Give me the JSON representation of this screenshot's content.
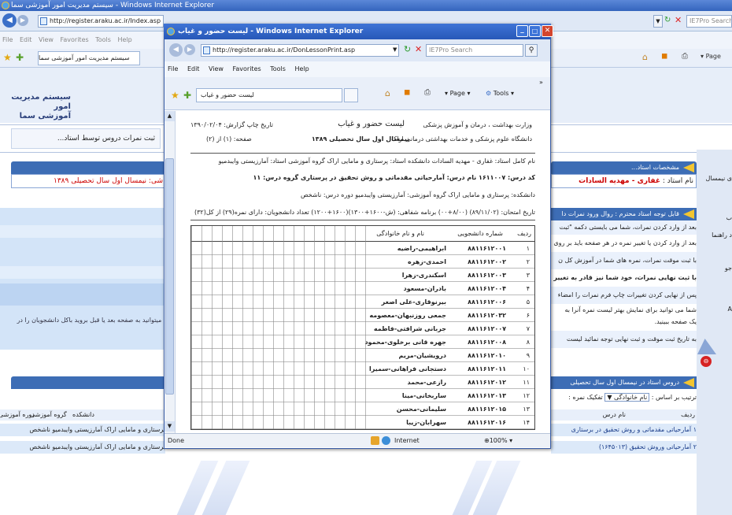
{
  "outer": {
    "title": "سیستم مدیریت امور آموزشی سما - Windows Internet Explorer",
    "address": "http://register.araku.ac.ir/Index.asp",
    "search_placeholder": "IE7Pro Search",
    "menu": [
      "File",
      "Edit",
      "View",
      "Favorites",
      "Tools",
      "Help"
    ],
    "tab_title": "سیستم مدیریت امور آموزشی سما",
    "toolbar_page": "Page"
  },
  "site": {
    "logo_line1": "سیستم مدیریت امور",
    "logo_line2": "آموزشی سما",
    "nav_current": "ثبت نمرات دروس توسط استاد...",
    "left_text_1": "شی: نیمسال اول سال تحصیلی ۱۳۸۹",
    "left_text_2": "ا میتوانید به صفحه بعد یا قبل بروید باکل دانشجویان را در",
    "teacher_panel_title": "مشخصات استاد...",
    "teacher_label": "نام استاد :",
    "teacher_name": "غفاری - مهدیه السادات",
    "notice_title": "قابل توجه استاد محترم : روال ورود نمرات دا",
    "notices": [
      "بعد از وارد کردن نمرات، شما می بایستی دکمه \"ثبت",
      "بعد از وارد کردن یا تغییر نمره در هر صفحه باید بر روی",
      "با ثبت موقت نمرات، نمره های شما در آموزش کل ن",
      "با ثبت نهایی نمرات، خود شما نیز قادر به تغییر",
      "پس از نهایی کردن تغییرات چاپ فرم نمرات را امضاء",
      "شما می توانید برای نمایش بهتر لیست نمره آنرا به",
      "یک صفحه ببینید.",
      "به تاریخ ثبت موقت و ثبت نهایی توجه نمائید لیست"
    ],
    "right_edge": [
      "ی نیمسال",
      "ب",
      "د راهنما",
      "جو",
      "A"
    ],
    "courses_title": "دروس استاد در نیمسال اول سال تحصیلی",
    "sort_label": "ترتیب بر اساس :",
    "sort_value": "نام خانوادگی",
    "sort_label2": "تفکیک نمره :",
    "col_left_headers": [
      "دانشکده",
      "گروه آموزشی",
      "دوره آموزشی"
    ],
    "col_right_headers": [
      "ردیف",
      "نام درس"
    ],
    "course_rows": [
      {
        "idx": "۱",
        "name": "آمارحیاتی مقدماتی و روش تحقیق در برستاری",
        "left": "برستاری و مامایی اراک  آمارزیستی وایبدمیو  ناشخص"
      },
      {
        "idx": "۲",
        "name": "آمارحیاتی وروش تحقیق (۱۶۴۵۰۱۳)",
        "left": "برستاری و مامایی اراک  آمارزیستی وایبدمیو  ناشخص"
      }
    ]
  },
  "popup": {
    "title": "لیست حضور و غیاب - Windows Internet Explorer",
    "address": "http://register.araku.ac.ir/DonLessonPrint.asp",
    "search_placeholder": "IE7Pro Search",
    "menu": [
      "File",
      "Edit",
      "View",
      "Favorites",
      "Tools",
      "Help"
    ],
    "tab_title": "لیست حضور و غیاب",
    "tools_page": "Page",
    "tools_tools": "Tools",
    "status_done": "Done",
    "status_zone": "Internet",
    "status_zoom": "100%",
    "doc": {
      "org_line1": "وزارت بهداشت ، درمان و آموزش پزشکی",
      "org_line2": "دانشگاه علوم پزشکی و خدمات بهداشتی درمانی اراک",
      "title": "لیست حضور و غیاب",
      "term": "نیمسال اول سال تحصیلی ۱۳۸۹",
      "print_date": "تاریخ چاپ گزارش: ۱۳۹۰/۰۲/۰۴",
      "page": "صفحه: (۱) از (۲)",
      "row1": "نام کامل استاد: غفاری - مهدیه السادات  دانشکده استاد: پرستاری و مامایی اراک  گروه آموزشی استاد: آمارزیستی وایبدمیو",
      "row2": "کد درس: ۱۶۱۱۰۰۷  نام درس: آمارحیاتی مقدماتی و روش تحقیق در پرستاری  گروه درس: ۱۱",
      "row3": "دانشکده: پرستاری و مامایی اراک  گروه آموزشی: آمارزیستی وایبدمیو  دوره درس: ناشخص",
      "row4": "تاریخ امتحان: (۸۹/۱۱/۰۲) (۸/۰۰+۰۰)  برنامه شفاهی: (ش-۱۶۰۰+۱۳۰۰)(۱۶۰۰+۱۲۰۰)  تعداد دانشجویان: دارای نمره(۲۹) از کل(۳۲)",
      "headers": [
        "ردیف",
        "شماره دانشجویی",
        "نام و نام خانوادگی"
      ],
      "students": [
        {
          "n": "۱",
          "id": "۸۸۱۱۶۱۲۰۰۱",
          "name": "ابراهیمی-راضیه"
        },
        {
          "n": "۲",
          "id": "۸۸۱۱۶۱۲۰۰۲",
          "name": "احمدی-زهره"
        },
        {
          "n": "۳",
          "id": "۸۸۱۱۶۱۲۰۰۳",
          "name": "اسکندری-زهرا"
        },
        {
          "n": "۴",
          "id": "۸۸۱۱۶۱۲۰۰۴",
          "name": "بادران-مسعود"
        },
        {
          "n": "۵",
          "id": "۸۸۱۱۶۱۲۰۰۶",
          "name": "بیرنوقاری-علی اصغر"
        },
        {
          "n": "۶",
          "id": "۸۸۱۱۶۱۲۰۳۲",
          "name": "جمعی روزنبهان-معصومه"
        },
        {
          "n": "۷",
          "id": "۸۸۱۱۶۱۲۰۰۷",
          "name": "جربانی شرافتی-فاطمه"
        },
        {
          "n": "۸",
          "id": "۸۸۱۱۶۱۲۰۰۸",
          "name": "جهره قانی برخلوی-محمود"
        },
        {
          "n": "۹",
          "id": "۸۸۱۱۶۱۲۰۱۰",
          "name": "درویشیان-مریم"
        },
        {
          "n": "۱۰",
          "id": "۸۸۱۱۶۱۲۰۱۱",
          "name": "دستجانی فراهانی-سمیرا"
        },
        {
          "n": "۱۱",
          "id": "۸۸۱۱۶۱۲۰۱۲",
          "name": "رازعی-محمد"
        },
        {
          "n": "۱۲",
          "id": "۸۸۱۱۶۱۲۰۱۳",
          "name": "ساربخانی-مینا"
        },
        {
          "n": "۱۳",
          "id": "۸۸۱۱۶۱۲۰۱۵",
          "name": "سلیمانی-محسن"
        },
        {
          "n": "۱۴",
          "id": "۸۸۱۱۶۱۲۰۱۶",
          "name": "سهرابان-زیبا"
        }
      ]
    }
  },
  "colors": {
    "ie_blue": "#3d6db5",
    "popup_title": "#2a5ab0",
    "accent_red": "#cc0000",
    "light_row": "#cfe2f8"
  }
}
